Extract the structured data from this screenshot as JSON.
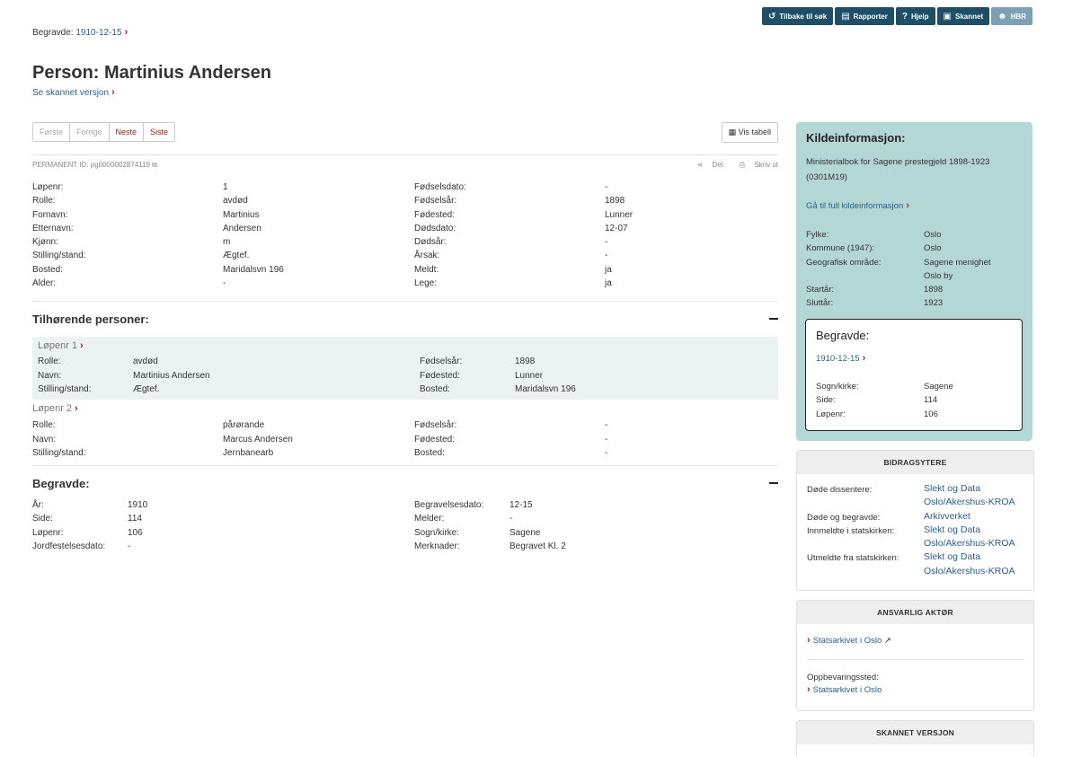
{
  "topbar": {
    "buttons": [
      {
        "label": "Tilbake til søk",
        "icon": "undo-icon"
      },
      {
        "label": "Rapporter",
        "icon": "report-icon"
      },
      {
        "label": "Hjelp",
        "icon": "question-icon"
      },
      {
        "label": "Skannet",
        "icon": "document-icon"
      },
      {
        "label": "HBR",
        "icon": "people-icon"
      }
    ]
  },
  "breadcrumb": {
    "prefix": "Begravde:",
    "link": "1910-12-15"
  },
  "page": {
    "title": "Person: Martinius Andersen",
    "scan_link": "Se skannet versjon"
  },
  "pager": {
    "first": "Første",
    "prev": "Forrige",
    "next": "Neste",
    "last": "Siste",
    "table": "Vis tabell"
  },
  "permanent": {
    "id": "PERMANENT ID: pg0000002874119",
    "share": "Del",
    "print": "Skriv ut"
  },
  "person": {
    "left": [
      {
        "k": "Løpenr:",
        "v": "1"
      },
      {
        "k": "Rolle:",
        "v": "avdød"
      },
      {
        "k": "Fornavn:",
        "v": "Martinius"
      },
      {
        "k": "Etternavn:",
        "v": "Andersen"
      },
      {
        "k": "Kjønn:",
        "v": "m"
      },
      {
        "k": "Stilling/stand:",
        "v": "Ægtef."
      },
      {
        "k": "Bosted:",
        "v": "Maridalsvn 196"
      },
      {
        "k": "Alder:",
        "v": "-"
      }
    ],
    "right": [
      {
        "k": "Fødselsdato:",
        "v": "-"
      },
      {
        "k": "Fødselsår:",
        "v": "1898"
      },
      {
        "k": "Fødested:",
        "v": "Lunner"
      },
      {
        "k": "Dødsdato:",
        "v": "12-07"
      },
      {
        "k": "Dødsår:",
        "v": "-"
      },
      {
        "k": "Årsak:",
        "v": "-"
      },
      {
        "k": "Meldt:",
        "v": "ja"
      },
      {
        "k": "Lege:",
        "v": "ja"
      }
    ]
  },
  "related": {
    "heading": "Tilhørende personer:",
    "people": [
      {
        "title": "Løpenr 1",
        "rows": [
          [
            "Rolle:",
            "avdød",
            "Fødselsår:",
            "1898"
          ],
          [
            "Navn:",
            "Martinius Andersen",
            "Fødested:",
            "Lunner"
          ],
          [
            "Stilling/stand:",
            "Ægtef.",
            "Bosted:",
            "Maridalsvn 196"
          ]
        ]
      },
      {
        "title": "Løpenr 2",
        "rows": [
          [
            "Rolle:",
            "pårørande",
            "Fødselsår:",
            "-"
          ],
          [
            "Navn:",
            "Marcus Andersen",
            "Fødested:",
            "-"
          ],
          [
            "Stilling/stand:",
            "Jernbanearb",
            "Bosted:",
            "-"
          ]
        ]
      }
    ]
  },
  "burial": {
    "heading": "Begravde:",
    "rows": [
      [
        "År:",
        "1910",
        "Begravelsesdato:",
        "12-15"
      ],
      [
        "Side:",
        "114",
        "Melder:",
        "-"
      ],
      [
        "Løpenr:",
        "106",
        "Sogn/kirke:",
        "Sagene"
      ],
      [
        "Jordfestelsesdato:",
        "-",
        "Merknader:",
        "Begravet Kl. 2"
      ]
    ]
  },
  "kilde": {
    "heading": "Kildeinformasjon:",
    "source": "Ministerialbok for Sagene prestegjeld 1898-1923 (0301M19)",
    "full_link": "Gå til full kildeinformasjon",
    "rows": [
      [
        "Fylke:",
        "Oslo"
      ],
      [
        "Kommune (1947):",
        "Oslo"
      ],
      [
        "Geografisk område:",
        "Sagene menighet"
      ],
      [
        "",
        "Oslo by"
      ],
      [
        "Startår:",
        "1898"
      ],
      [
        "Sluttår:",
        "1923"
      ]
    ],
    "box": {
      "heading": "Begravde:",
      "link": "1910-12-15",
      "rows": [
        [
          "Sogn/kirke:",
          "Sagene"
        ],
        [
          "Side:",
          "114"
        ],
        [
          "Løpenr:",
          "106"
        ]
      ]
    }
  },
  "contributors": {
    "heading": "BIDRAGSYTERE",
    "rows": [
      [
        "Døde dissentere:",
        "Slekt og Data"
      ],
      [
        "",
        "Oslo/Akershus-KROA"
      ],
      [
        "Døde og begravde:",
        "Arkivverket"
      ],
      [
        "Innmeldte i statskirken:",
        "Slekt og Data"
      ],
      [
        "",
        "Oslo/Akershus-KROA"
      ],
      [
        "Utmeldte fra statskirken:",
        "Slekt og Data"
      ],
      [
        "",
        "Oslo/Akershus-KROA"
      ]
    ]
  },
  "responsible": {
    "heading": "ANSVARLIG AKTØR",
    "link": "Statsarkivet i Oslo",
    "storage_label": "Oppbevaringssted:",
    "storage_link": "Statsarkivet i Oslo"
  },
  "scanned": {
    "heading": "SKANNET VERSJON"
  }
}
